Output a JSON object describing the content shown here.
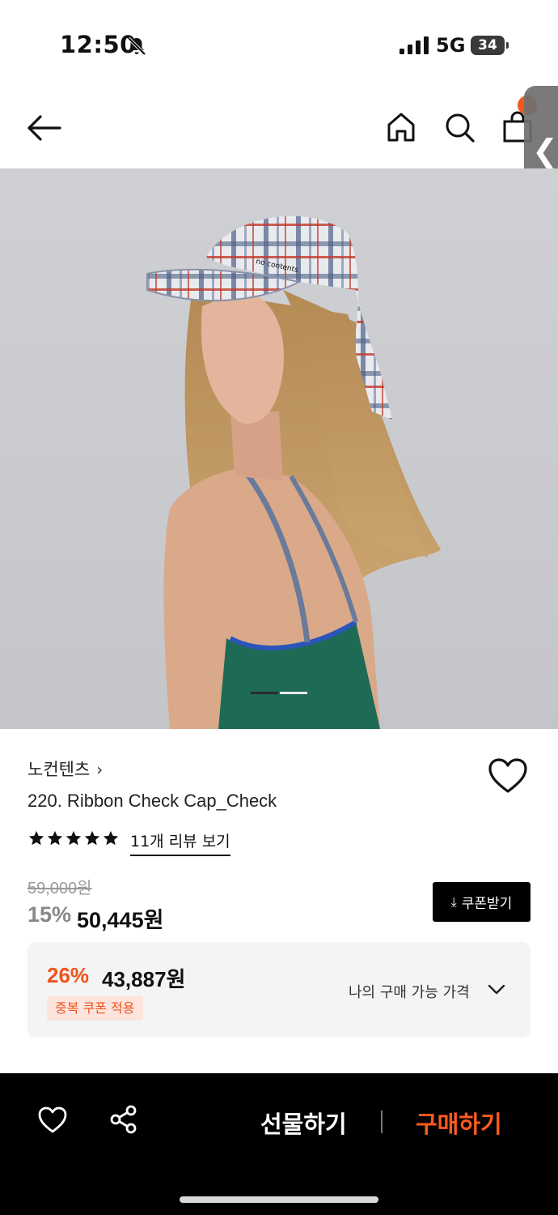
{
  "status_bar": {
    "time": "12:50",
    "network": "5G",
    "battery": "34"
  },
  "nav": {
    "cart_badge_color": "#f05a22"
  },
  "product": {
    "brand": "노컨텐츠",
    "brand_chevron": "›",
    "name": "220. Ribbon Check Cap_Check",
    "rating_stars": 5,
    "review_link": "11개 리뷰 보기",
    "original_price": "59,000원",
    "discount": "15%",
    "price": "50,445원",
    "coupon_button": "쿠폰받기",
    "best_price": {
      "discount": "26%",
      "price": "43,887원",
      "badge": "중복 쿠폰 적용",
      "my_price_label": "나의 구매 가능 가격"
    },
    "image_pages": {
      "current": 1,
      "total": 2
    }
  },
  "bottom_bar": {
    "gift_label": "선물하기",
    "buy_label": "구매하기",
    "buy_color": "#ff5a1f"
  },
  "side_tab": {
    "label": "❮"
  }
}
